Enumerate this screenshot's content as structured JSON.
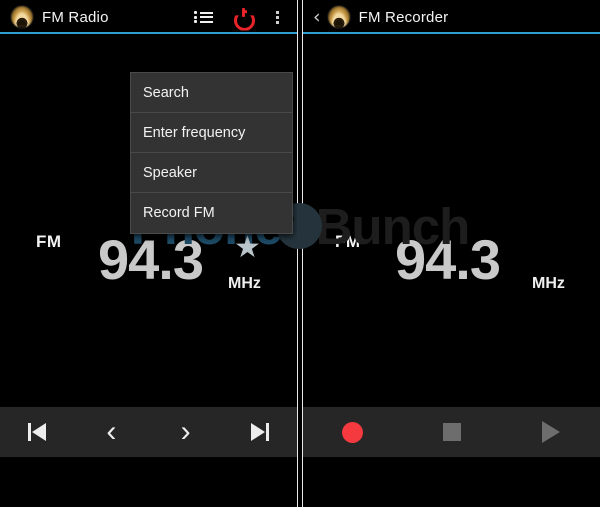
{
  "watermark": {
    "text_left": "Phone",
    "text_right": "Bunch",
    "badge_icon": "phone-handset-icon",
    "color_left": "#1d4a66",
    "color_right": "#1d1d1d"
  },
  "left_panel": {
    "actionbar": {
      "app_icon": "fm-radio-app-icon",
      "title": "FM Radio",
      "list_icon": "station-list-icon",
      "power_icon": "power-toggle-icon",
      "power_color": "#e8242a",
      "overflow_icon": "overflow-menu-icon"
    },
    "menu": {
      "items": [
        {
          "label": "Search"
        },
        {
          "label": "Enter frequency"
        },
        {
          "label": "Speaker"
        },
        {
          "label": "Record FM"
        }
      ]
    },
    "tuner": {
      "band": "FM",
      "frequency": "94.3",
      "unit": "MHz",
      "favorite_icon": "star-icon",
      "favorite_color": "#b9c4ca"
    },
    "controls": [
      {
        "name": "skip-previous-button",
        "icon": "skip-previous-icon"
      },
      {
        "name": "previous-station-button",
        "icon": "chevron-left-icon",
        "glyph": "‹"
      },
      {
        "name": "next-station-button",
        "icon": "chevron-right-icon",
        "glyph": "›"
      },
      {
        "name": "skip-next-button",
        "icon": "skip-next-icon"
      }
    ]
  },
  "right_panel": {
    "actionbar": {
      "back_icon": "back-chevron-icon",
      "back_glyph": "‹",
      "app_icon": "fm-radio-app-icon",
      "title": "FM Recorder"
    },
    "tuner": {
      "band": "FM",
      "frequency": "94.3",
      "unit": "MHz"
    },
    "controls": [
      {
        "name": "record-button",
        "icon": "record-circle-icon",
        "color": "#f4393f"
      },
      {
        "name": "stop-button",
        "icon": "stop-square-icon",
        "color": "#6d6d6d"
      },
      {
        "name": "play-button",
        "icon": "play-triangle-icon",
        "color": "#6d6d6d"
      }
    ]
  },
  "theme": {
    "accent": "#2f9fd0",
    "background": "#000000",
    "controlbar_bg": "#262626",
    "menu_bg": "#333333"
  }
}
